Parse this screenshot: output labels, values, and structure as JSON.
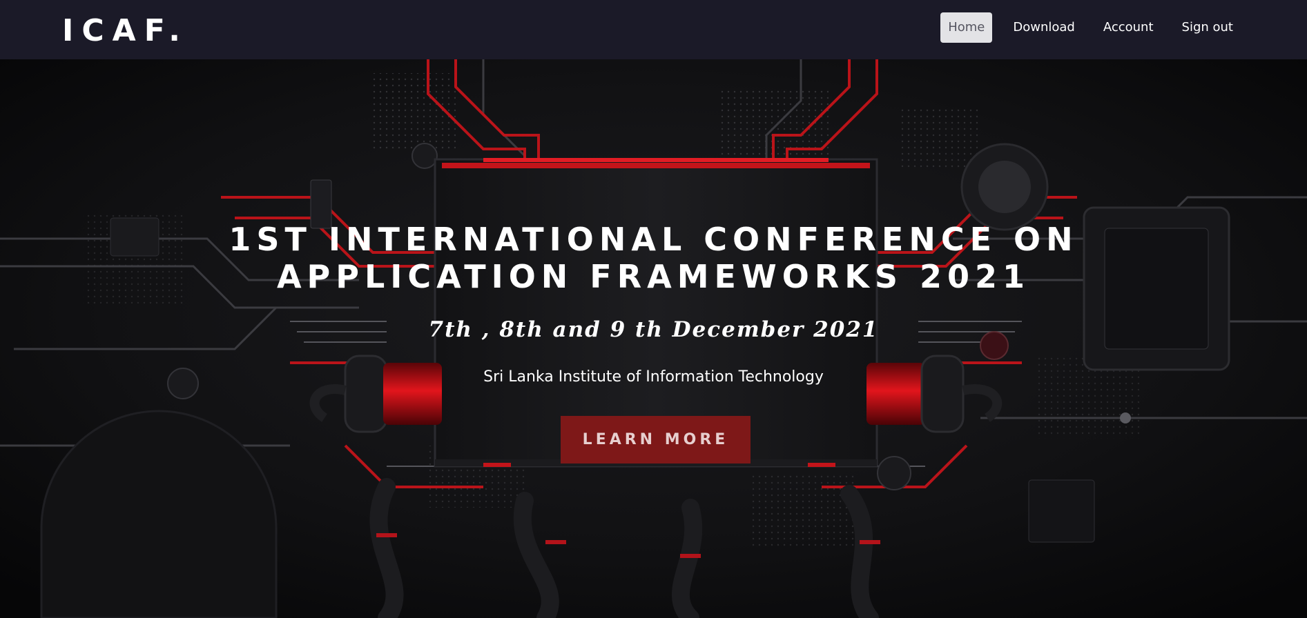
{
  "brand": "ICAF.",
  "nav": {
    "items": [
      "Home",
      "Download",
      "Account",
      "Sign out"
    ],
    "active": "Home"
  },
  "hero": {
    "headline_line1": "1ST INTERNATIONAL CONFERENCE ON",
    "headline_line2": "APPLICATION FRAMEWORKS 2021",
    "dates": "7th , 8th and 9 th December 2021",
    "institute": "Sri Lanka Institute of Information Technology",
    "cta_label": "LEARN MORE"
  },
  "colors": {
    "navbar_bg": "#1b1a28",
    "accent_red": "#c3141a",
    "cta_bg": "#7e1818",
    "active_nav_bg": "#e3e3e6"
  }
}
